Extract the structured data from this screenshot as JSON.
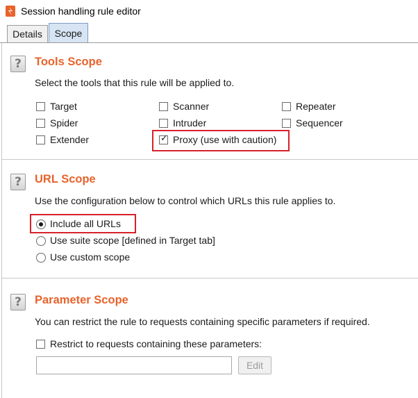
{
  "window": {
    "title": "Session handling rule editor",
    "icon": "burp-logo-icon"
  },
  "tabs": [
    {
      "label": "Details",
      "selected": false
    },
    {
      "label": "Scope",
      "selected": true
    }
  ],
  "tools_scope": {
    "title": "Tools Scope",
    "description": "Select the tools that this rule will be applied to.",
    "tools": [
      {
        "label": "Target",
        "checked": false
      },
      {
        "label": "Scanner",
        "checked": false
      },
      {
        "label": "Repeater",
        "checked": false
      },
      {
        "label": "Spider",
        "checked": false
      },
      {
        "label": "Intruder",
        "checked": false
      },
      {
        "label": "Sequencer",
        "checked": false
      },
      {
        "label": "Extender",
        "checked": false
      },
      {
        "label": "Proxy (use with caution)",
        "checked": true
      }
    ]
  },
  "url_scope": {
    "title": "URL Scope",
    "description": "Use the configuration below to control which URLs this rule applies to.",
    "options": [
      {
        "label": "Include all URLs",
        "selected": true
      },
      {
        "label": "Use suite scope [defined in Target tab]",
        "selected": false
      },
      {
        "label": "Use custom scope",
        "selected": false
      }
    ]
  },
  "parameter_scope": {
    "title": "Parameter Scope",
    "description": "You can restrict the rule to requests containing specific parameters if required.",
    "restrict_label": "Restrict to requests containing these parameters:",
    "restrict_checked": false,
    "parameters_value": "",
    "edit_label": "Edit",
    "edit_enabled": false
  },
  "colors": {
    "section_title": "#e8632c",
    "highlight": "#d8202a"
  }
}
